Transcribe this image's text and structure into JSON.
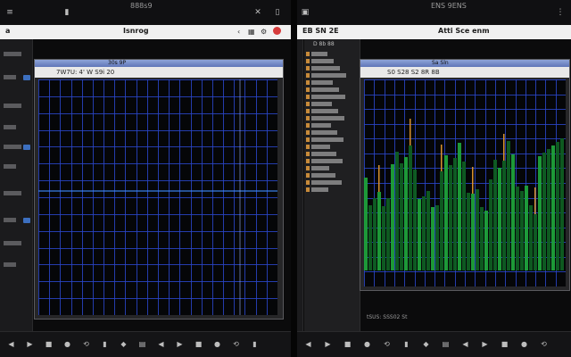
{
  "left": {
    "top_title": "Isnrog",
    "top_subtitle": "888s9",
    "sub_label": "a",
    "window": {
      "title": "30s 9P",
      "menu": "7W7U: 4' W S9i 20"
    }
  },
  "right": {
    "top_title": "Atti Sce enm",
    "top_subtitle": "ENS 9ENS",
    "sub_label": "EB SN 2E",
    "library_heading": "D 8b 88",
    "window": {
      "title": "Sa Sln",
      "menu": "S0 S28 S2 8R 8B"
    },
    "status_text": "tSUS: SSS02 St"
  },
  "colors": {
    "grid": "#2a46c9",
    "bars_green": "#1fa13a",
    "bars_green_dark": "#0f5e22",
    "bars_orange": "#d9922e",
    "trace_blue": "#3f8cff",
    "record_red": "#d63c3c"
  }
}
